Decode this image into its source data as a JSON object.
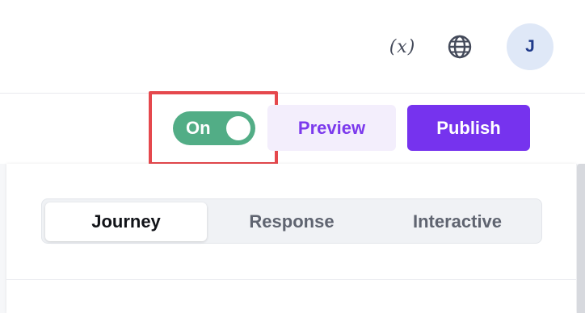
{
  "header": {
    "variables_icon_text": "(x)",
    "avatar_initial": "J"
  },
  "toolbar": {
    "toggle_label": "On",
    "toggle_state": "on",
    "preview_label": "Preview",
    "publish_label": "Publish"
  },
  "tabs": [
    {
      "label": "Journey",
      "active": true
    },
    {
      "label": "Response",
      "active": false
    },
    {
      "label": "Interactive",
      "active": false
    }
  ],
  "colors": {
    "accent_purple": "#7633ee",
    "toggle_green": "#52ad86",
    "highlight_red": "#e5484d"
  }
}
